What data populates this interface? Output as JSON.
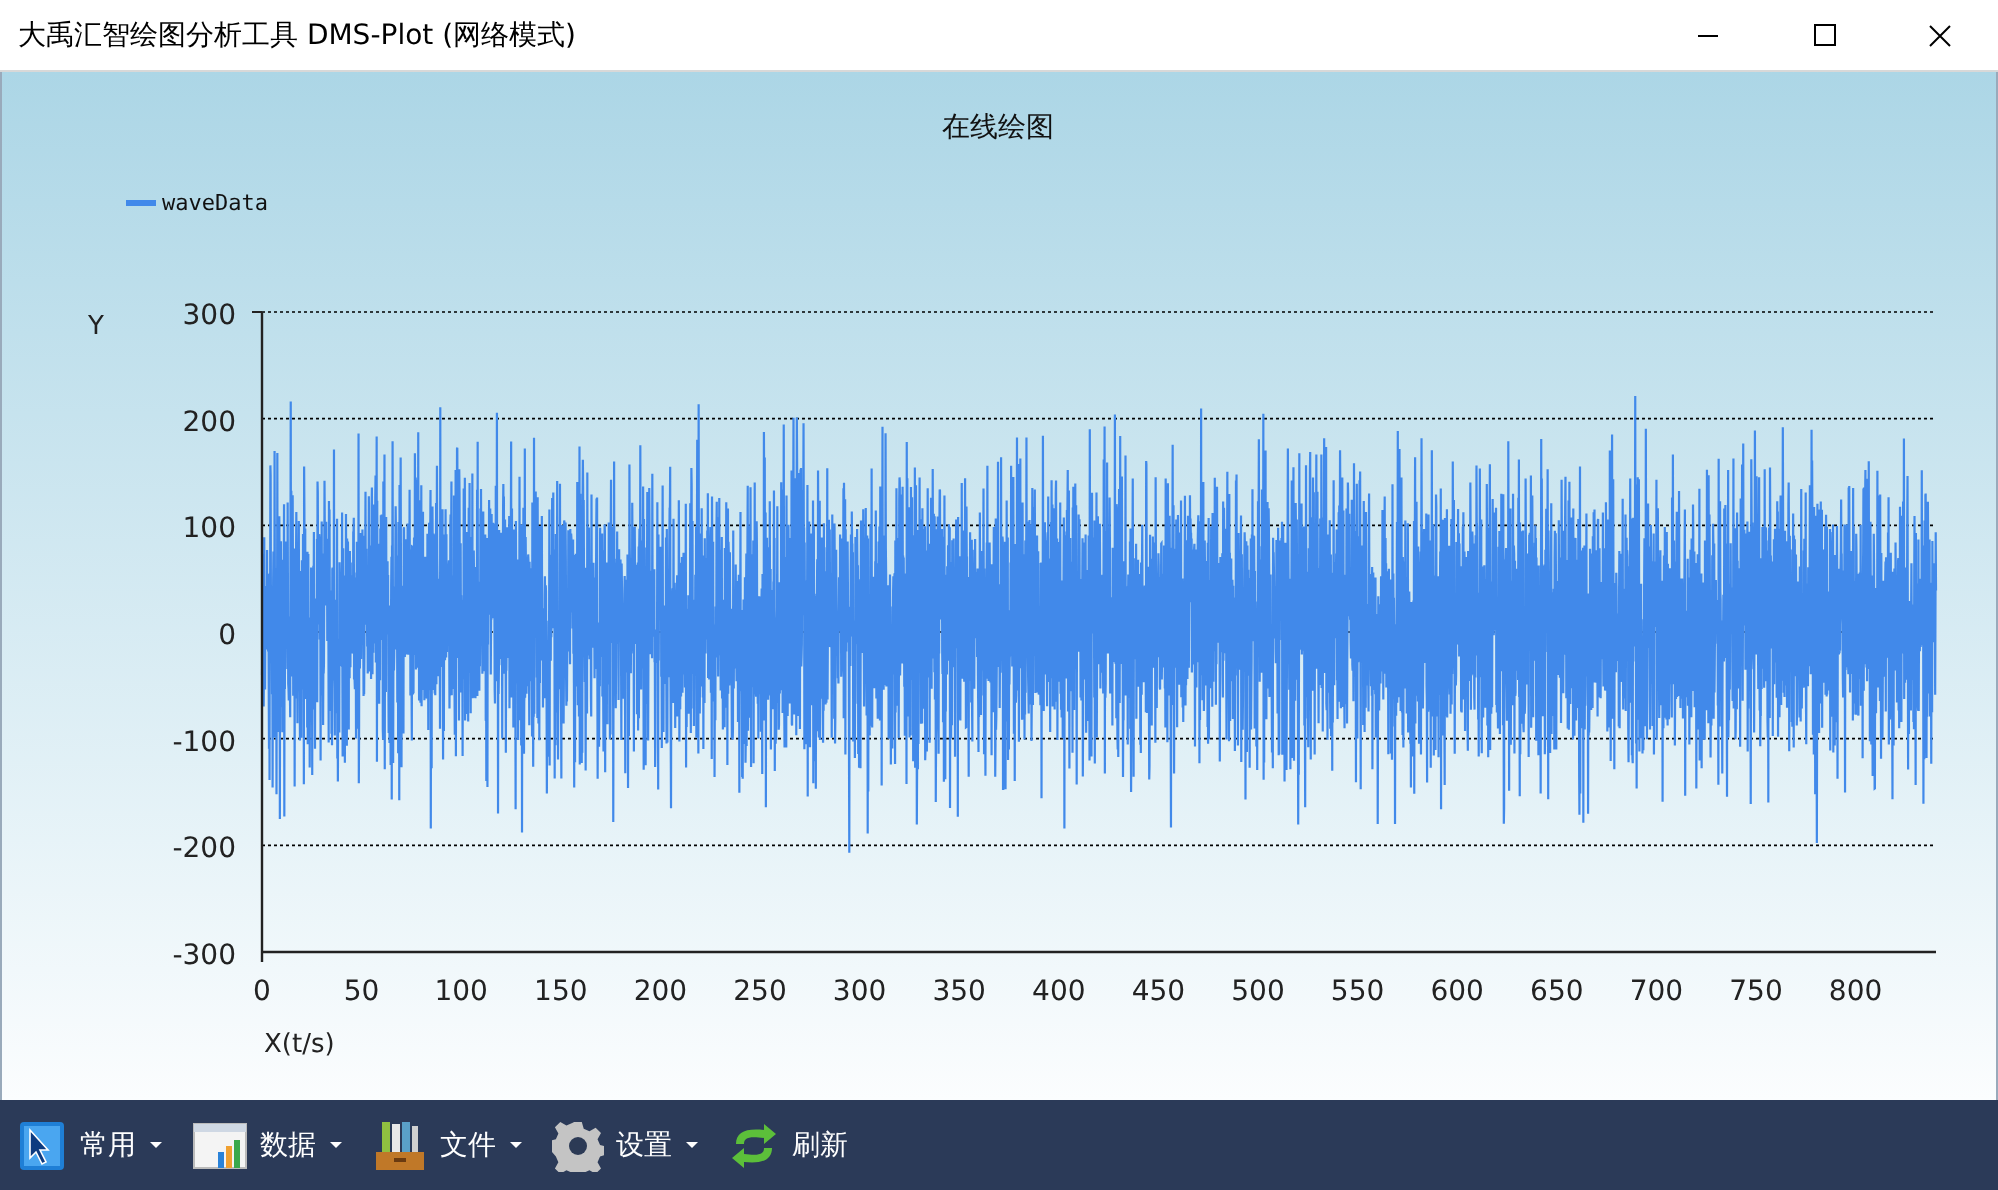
{
  "window": {
    "title": "大禹汇智绘图分析工具 DMS-Plot (网络模式)"
  },
  "chart": {
    "title": "在线绘图",
    "legend": [
      {
        "name": "waveData",
        "color": "#4189ea"
      }
    ],
    "ylabel": "Y",
    "xlabel": "X(t/s)",
    "yticks": [
      "300",
      "200",
      "100",
      "0",
      "-100",
      "-200",
      "-300"
    ],
    "xticks": [
      "0",
      "50",
      "100",
      "150",
      "200",
      "250",
      "300",
      "350",
      "400",
      "450",
      "500",
      "550",
      "600",
      "650",
      "700",
      "750",
      "800"
    ]
  },
  "toolbar": [
    {
      "label": "常用",
      "kind": "dropdown"
    },
    {
      "label": "数据",
      "kind": "dropdown"
    },
    {
      "label": "文件",
      "kind": "dropdown"
    },
    {
      "label": "设置",
      "kind": "dropdown"
    },
    {
      "label": "刷新",
      "kind": "button"
    }
  ]
}
